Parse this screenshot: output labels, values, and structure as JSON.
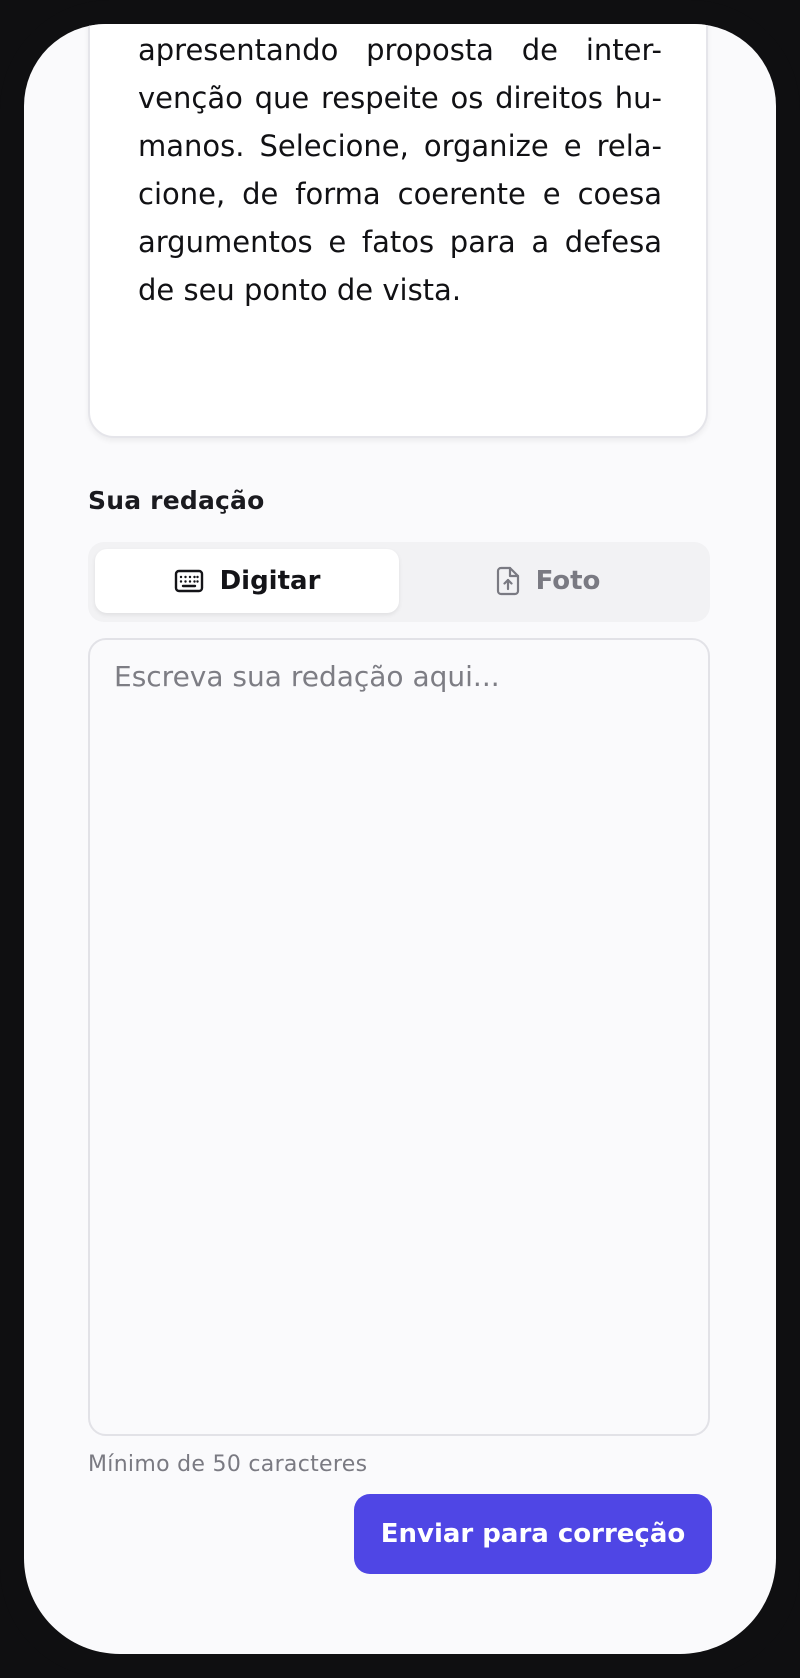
{
  "prompt": {
    "lines": [
      "apresentando proposta de inter-",
      "venção que respeite os direitos hu-",
      "manos. Selecione, organize e rela-",
      "cione, de forma coerente e coesa",
      "argumentos e fatos para a defesa",
      "de seu ponto de vista."
    ]
  },
  "essay": {
    "section_label": "Sua redação",
    "modes": [
      {
        "label": "Digitar",
        "icon": "keyboard-icon",
        "active": true
      },
      {
        "label": "Foto",
        "icon": "file-upload-icon",
        "active": false
      }
    ],
    "placeholder": "Escreva sua redação aqui...",
    "value": "",
    "hint": "Mínimo de 50 caracteres",
    "submit_label": "Enviar para correção"
  },
  "colors": {
    "accent": "#4f46e5",
    "background": "#fafafc",
    "frame": "#0f0f11"
  }
}
